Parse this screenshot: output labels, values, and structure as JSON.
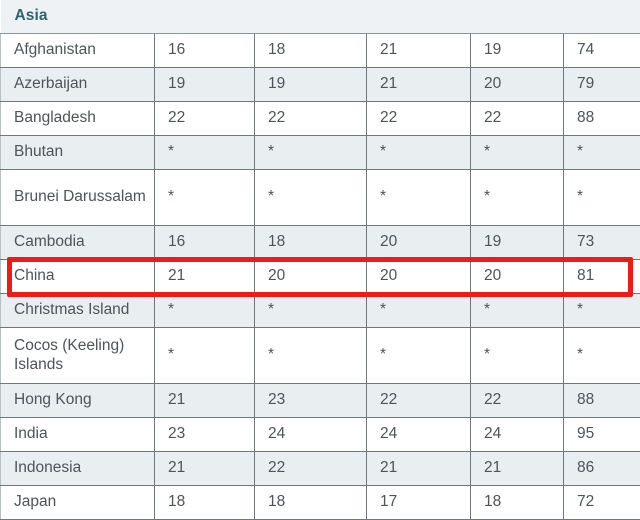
{
  "table": {
    "section_title": "Asia",
    "columns": [
      "country",
      "v1",
      "v2",
      "v3",
      "v4",
      "v5"
    ],
    "rows": [
      {
        "country": "Afghanistan",
        "v1": "16",
        "v2": "18",
        "v3": "21",
        "v4": "19",
        "v5": "74",
        "shaded": false,
        "tall": false,
        "highlighted": false
      },
      {
        "country": "Azerbaijan",
        "v1": "19",
        "v2": "19",
        "v3": "21",
        "v4": "20",
        "v5": "79",
        "shaded": true,
        "tall": false,
        "highlighted": false
      },
      {
        "country": "Bangladesh",
        "v1": "22",
        "v2": "22",
        "v3": "22",
        "v4": "22",
        "v5": "88",
        "shaded": false,
        "tall": false,
        "highlighted": false
      },
      {
        "country": "Bhutan",
        "v1": "*",
        "v2": "*",
        "v3": "*",
        "v4": "*",
        "v5": "*",
        "shaded": true,
        "tall": false,
        "highlighted": false
      },
      {
        "country": "Brunei Darussalam",
        "v1": "*",
        "v2": "*",
        "v3": "*",
        "v4": "*",
        "v5": "*",
        "shaded": false,
        "tall": true,
        "highlighted": false
      },
      {
        "country": "Cambodia",
        "v1": "16",
        "v2": "18",
        "v3": "20",
        "v4": "19",
        "v5": "73",
        "shaded": true,
        "tall": false,
        "highlighted": false
      },
      {
        "country": "China",
        "v1": "21",
        "v2": "20",
        "v3": "20",
        "v4": "20",
        "v5": "81",
        "shaded": false,
        "tall": false,
        "highlighted": true
      },
      {
        "country": "Christmas Island",
        "v1": "*",
        "v2": "*",
        "v3": "*",
        "v4": "*",
        "v5": "*",
        "shaded": true,
        "tall": false,
        "highlighted": false
      },
      {
        "country": "Cocos (Keeling) Islands",
        "v1": "*",
        "v2": "*",
        "v3": "*",
        "v4": "*",
        "v5": "*",
        "shaded": false,
        "tall": true,
        "highlighted": false
      },
      {
        "country": "Hong Kong",
        "v1": "21",
        "v2": "23",
        "v3": "22",
        "v4": "22",
        "v5": "88",
        "shaded": true,
        "tall": false,
        "highlighted": false
      },
      {
        "country": "India",
        "v1": "23",
        "v2": "24",
        "v3": "24",
        "v4": "24",
        "v5": "95",
        "shaded": false,
        "tall": false,
        "highlighted": false
      },
      {
        "country": "Indonesia",
        "v1": "21",
        "v2": "22",
        "v3": "21",
        "v4": "21",
        "v5": "86",
        "shaded": true,
        "tall": false,
        "highlighted": false
      },
      {
        "country": "Japan",
        "v1": "18",
        "v2": "18",
        "v3": "17",
        "v4": "18",
        "v5": "72",
        "shaded": false,
        "tall": false,
        "highlighted": false
      }
    ]
  },
  "annotation": {
    "type": "rectangle",
    "target_row": "China",
    "color": "#ee1c18"
  }
}
